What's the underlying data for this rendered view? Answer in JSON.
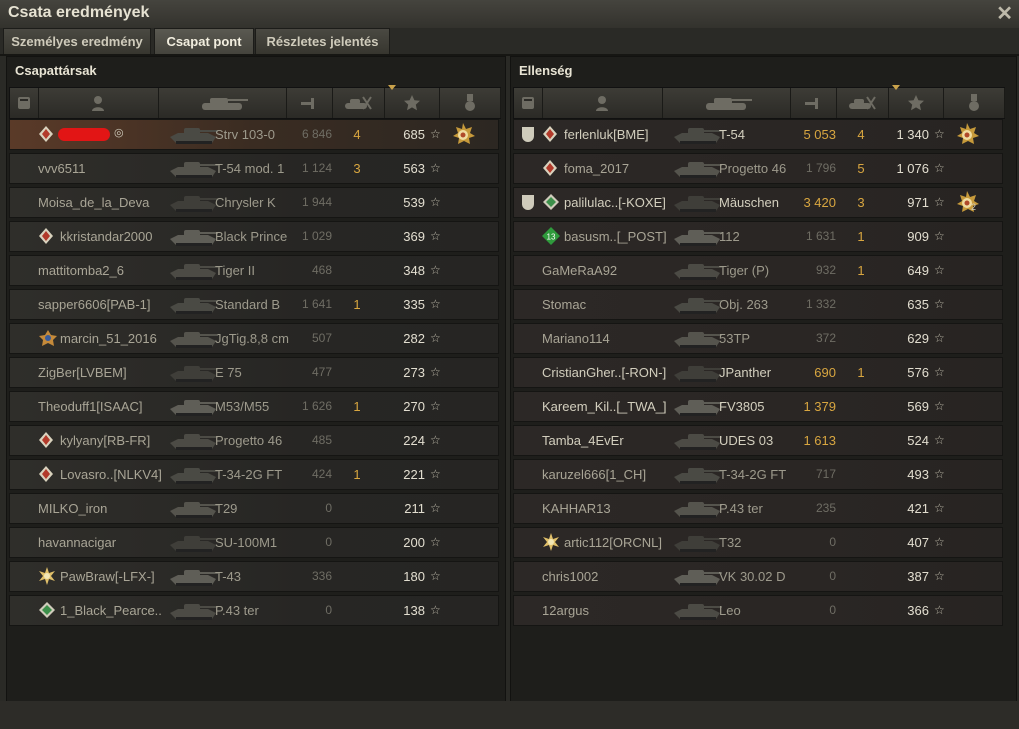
{
  "window": {
    "title": "Csata eredmények"
  },
  "tabs": [
    {
      "label": "Személyes eredmény",
      "active": false
    },
    {
      "label": "Csapat pont",
      "active": true
    },
    {
      "label": "Részletes jelentés",
      "active": false
    }
  ],
  "allies": {
    "title": "Csapattársak",
    "rows": [
      {
        "name": "",
        "tank": "Strv 103-0",
        "damage": "6 846",
        "kills": "4",
        "xp": "685",
        "self": true,
        "name_hidden": true,
        "rank_icon": "rank-diamond-icon",
        "badge": "mastery-medal-icon"
      },
      {
        "name": "vvv6511",
        "tank": "T-54 mod. 1",
        "damage": "1 124",
        "kills": "3",
        "xp": "563"
      },
      {
        "name": "Moisa_de_la_Deva",
        "tank": "Chrysler K",
        "damage": "1 944",
        "kills": "",
        "xp": "539"
      },
      {
        "name": "kkristandar2000",
        "tank": "Black Prince",
        "damage": "1 029",
        "kills": "",
        "xp": "369",
        "rank_icon": "rank-diamond-icon"
      },
      {
        "name": "mattitomba2_6",
        "tank": "Tiger II",
        "damage": "468",
        "kills": "",
        "xp": "348"
      },
      {
        "name": "sapper6606[PAB-1]",
        "tank": "Standard B",
        "damage": "1 641",
        "kills": "1",
        "xp": "335"
      },
      {
        "name": "marcin_51_2016",
        "tank": "JgTig.8,8 cm",
        "damage": "507",
        "kills": "",
        "xp": "282",
        "rank_icon": "rank-emblem-icon"
      },
      {
        "name": "ZigBer[LVBEM]",
        "tank": "E 75",
        "damage": "477",
        "kills": "",
        "xp": "273"
      },
      {
        "name": "Theoduff1[ISAAC]",
        "tank": "M53/M55",
        "damage": "1 626",
        "kills": "1",
        "xp": "270"
      },
      {
        "name": "kylyany[RB-FR]",
        "tank": "Progetto 46",
        "damage": "485",
        "kills": "",
        "xp": "224",
        "rank_icon": "rank-diamond-icon"
      },
      {
        "name": "Lovasro..[NLKV4]",
        "tank": "T-34-2G FT",
        "damage": "424",
        "kills": "1",
        "xp": "221",
        "rank_icon": "rank-diamond-icon"
      },
      {
        "name": "MILKO_iron",
        "tank": "T29",
        "damage": "0",
        "kills": "",
        "xp": "211"
      },
      {
        "name": "havannacigar",
        "tank": "SU-100M1",
        "damage": "0",
        "kills": "",
        "xp": "200"
      },
      {
        "name": "PawBraw[-LFX-]",
        "tank": "T-43",
        "damage": "336",
        "kills": "",
        "xp": "180",
        "rank_icon": "rank-star-icon"
      },
      {
        "name": "1_Black_Pearce..",
        "tank": "P.43 ter",
        "damage": "0",
        "kills": "",
        "xp": "138",
        "rank_icon": "rank-green-icon"
      }
    ]
  },
  "enemies": {
    "title": "Ellenség",
    "rows": [
      {
        "name": "ferlenluk[BME]",
        "tank": "T-54",
        "damage": "5 053",
        "kills": "4",
        "xp": "1 340",
        "platoon": true,
        "rank_icon": "rank-diamond-icon",
        "badge": "mastery-medal-icon",
        "bold": true
      },
      {
        "name": "foma_2017",
        "tank": "Progetto 46",
        "damage": "1 796",
        "kills": "5",
        "xp": "1 076",
        "rank_icon": "rank-diamond-icon"
      },
      {
        "name": "palilulac..[-KOXE]",
        "tank": "Mäuschen",
        "damage": "3 420",
        "kills": "3",
        "xp": "971",
        "platoon": true,
        "rank_icon": "rank-green-icon",
        "badge": "mastery-medal-icon",
        "badge_count": "2",
        "bold": true
      },
      {
        "name": "basusm..[_POST]",
        "tank": "112",
        "damage": "1 631",
        "kills": "1",
        "xp": "909",
        "rank_icon": "rank-13-icon",
        "rank_text": "13"
      },
      {
        "name": "GaMeRaA92",
        "tank": "Tiger (P)",
        "damage": "932",
        "kills": "1",
        "xp": "649"
      },
      {
        "name": "Stomac",
        "tank": "Obj. 263",
        "damage": "1 332",
        "kills": "",
        "xp": "635"
      },
      {
        "name": "Mariano114",
        "tank": "53TP",
        "damage": "372",
        "kills": "",
        "xp": "629"
      },
      {
        "name": "CristianGher..[-RON-]",
        "tank": "JPanther",
        "damage": "690",
        "kills": "1",
        "xp": "576",
        "bold": true
      },
      {
        "name": "Kareem_Kil..[_TWA_]",
        "tank": "FV3805",
        "damage": "1 379",
        "kills": "",
        "xp": "569",
        "bold": true
      },
      {
        "name": "Tamba_4EvEr",
        "tank": "UDES 03",
        "damage": "1 613",
        "kills": "",
        "xp": "524",
        "bold": true
      },
      {
        "name": "karuzel666[1_CH]",
        "tank": "T-34-2G FT",
        "damage": "717",
        "kills": "",
        "xp": "493"
      },
      {
        "name": "KAHHAR13",
        "tank": "P.43 ter",
        "damage": "235",
        "kills": "",
        "xp": "421"
      },
      {
        "name": "artic112[ORCNL]",
        "tank": "T32",
        "damage": "0",
        "kills": "",
        "xp": "407",
        "rank_icon": "rank-star-icon"
      },
      {
        "name": "chris1002",
        "tank": "VK 30.02 D",
        "damage": "0",
        "kills": "",
        "xp": "387"
      },
      {
        "name": "12argus",
        "tank": "Leo",
        "damage": "0",
        "kills": "",
        "xp": "366"
      }
    ]
  },
  "star_glyph": "☆",
  "close_glyph": "✕",
  "colors": {
    "highlight": "#d8a640",
    "self_row": "#5a3a28"
  }
}
